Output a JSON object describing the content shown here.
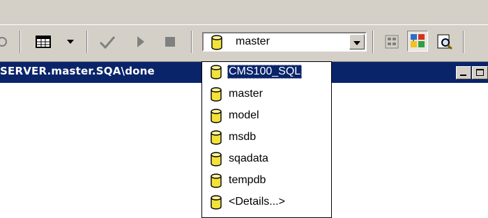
{
  "toolbar": {
    "database_combo": {
      "value": "master",
      "icon": "database-cylinder-icon"
    },
    "icons": [
      "partial-icon",
      "grid-results-icon",
      "chevron-down-icon",
      "checkmark-icon",
      "play-icon",
      "stop-icon",
      "object-browser-icon",
      "object-search-icon",
      "find-icon"
    ]
  },
  "window": {
    "title": "SERVER.master.SQA\\done"
  },
  "dropdown": {
    "items": [
      {
        "label": "CMS100_SQL",
        "selected": true
      },
      {
        "label": "master"
      },
      {
        "label": "model"
      },
      {
        "label": "msdb"
      },
      {
        "label": "sqadata"
      },
      {
        "label": "tempdb"
      },
      {
        "label": "<Details...>"
      }
    ]
  },
  "colors": {
    "chrome": "#d4d0c8",
    "titlebar": "#0a246a",
    "selection": "#0a246a",
    "cylinder": "#f2e23a"
  }
}
